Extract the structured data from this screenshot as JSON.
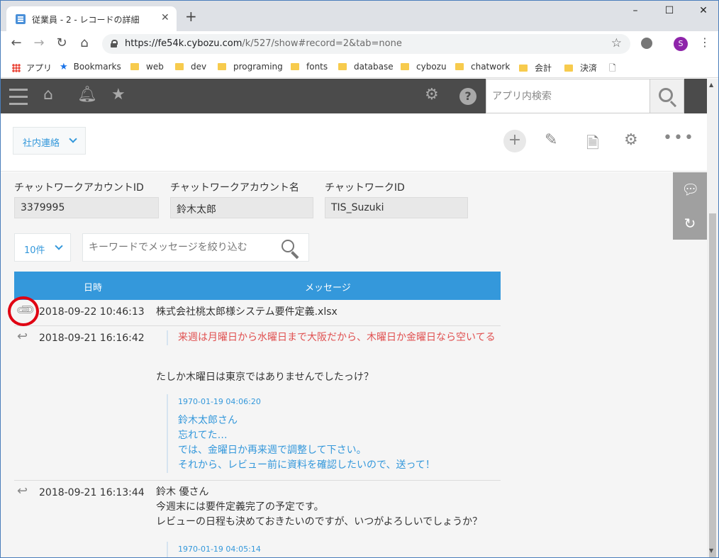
{
  "browser": {
    "tab_title": "従業員 - 2 - レコードの詳細",
    "tab_close": "✕",
    "new_tab": "+",
    "url_host": "https://fe54k.cybozu.com",
    "url_path": "/k/527/show#record=2&tab=none",
    "profile_initial": "S",
    "window_controls": [
      "–",
      "☐",
      "✕"
    ]
  },
  "bookmarks": {
    "apps": "アプリ",
    "items": [
      "Bookmarks",
      "web",
      "dev",
      "programing",
      "fonts",
      "database",
      "cybozu",
      "chatwork",
      "会計",
      "決済"
    ]
  },
  "app_header": {
    "search_placeholder": "アプリ内検索"
  },
  "view": {
    "selected_view": "社内連絡"
  },
  "fields": [
    {
      "label": "チャットワークアカウントID",
      "value": "3379995"
    },
    {
      "label": "チャットワークアカウント名",
      "value": "鈴木太郎"
    },
    {
      "label": "チャットワークID",
      "value": "TIS_Suzuki"
    }
  ],
  "filter": {
    "count_label": "10件",
    "keyword_placeholder": "キーワードでメッセージを絞り込む"
  },
  "table": {
    "headers": [
      "日時",
      "メッセージ"
    ],
    "rows": [
      {
        "icon": "paperclip-icon",
        "timestamp": "2018-09-22 10:46:13",
        "message": "株式会社桃太郎様システム要件定義.xlsx"
      },
      {
        "icon": "reply-icon",
        "timestamp": "2018-09-21 16:16:42",
        "quote_red": "来週は月曜日から水曜日まで大阪だから、木曜日か金曜日なら空いてる",
        "message": "たしか木曜日は東京ではありませんでしたっけ？",
        "quote_ts": "1970-01-19 04:06:20",
        "quote_lines": [
          "鈴木太郎さん",
          "忘れてた…",
          "では、金曜日か再来週で調整して下さい。",
          "それから、レビュー前に資料を確認したいので、送って！"
        ]
      },
      {
        "icon": "reply-icon",
        "timestamp": "2018-09-21 16:13:44",
        "message_lines": [
          "鈴木 優さん",
          "今週末には要件定義完了の予定です。",
          "レビューの日程も決めておきたいのですが、いつがよろしいでしょうか？"
        ],
        "quote_ts": "1970-01-19 04:05:14"
      }
    ]
  },
  "colors": {
    "accent": "#3498db",
    "header_bg": "#4b4b4b",
    "highlight": "#e00012",
    "quote_red": "#e05050"
  }
}
